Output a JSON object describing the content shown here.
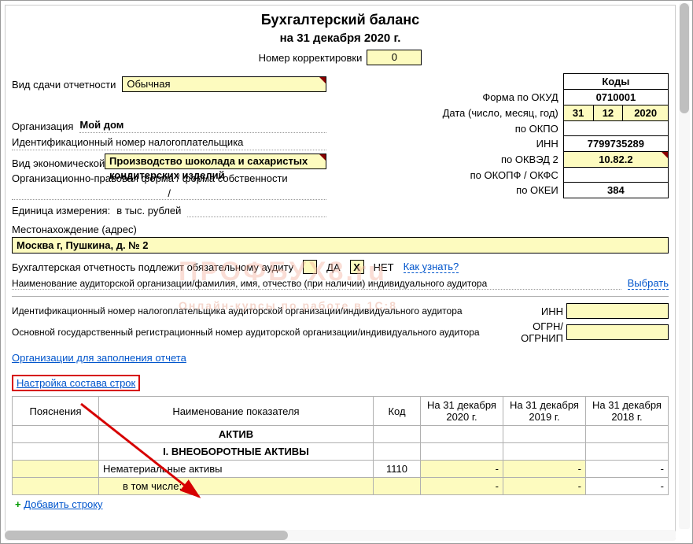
{
  "header": {
    "title": "Бухгалтерский баланс",
    "subtitle": "на 31 декабря 2020 г.",
    "correction_label": "Номер корректировки",
    "correction_value": "0"
  },
  "submission": {
    "label": "Вид сдачи отчетности",
    "value": "Обычная"
  },
  "codes": {
    "header": "Коды",
    "okud_label": "Форма по ОКУД",
    "okud": "0710001",
    "date_label": "Дата (число, месяц, год)",
    "date_day": "31",
    "date_month": "12",
    "date_year": "2020",
    "okpo_label": "по ОКПО",
    "okpo": "",
    "inn_label": "ИНН",
    "inn": "7799735289",
    "okved_label": "по ОКВЭД 2",
    "okved": "10.82.2",
    "okopf_label": "по ОКОПФ / ОКФС",
    "okopf": "",
    "okei_label": "по ОКЕИ",
    "okei": "384"
  },
  "org": {
    "label": "Организация",
    "name": "Мой дом",
    "inn_tax_label": "Идентификационный номер налогоплательщика",
    "activity_label": "Вид экономической деятельности",
    "activity": "Производство шоколада и сахаристых кондитерских изделий",
    "legal_form_label": "Организационно-правовая форма / форма собственности",
    "legal_form": "/",
    "units_label": "Единица измерения:",
    "units": "в тыс. рублей",
    "address_label": "Местонахождение (адрес)",
    "address": "Москва г, Пушкина, д. № 2"
  },
  "audit": {
    "label": "Бухгалтерская отчетность подлежит обязательному аудиту",
    "yes": "ДА",
    "no": "НЕТ",
    "no_checked": "Х",
    "how_link": "Как узнать?",
    "aud_name_label": "Наименование аудиторской организации/фамилия, имя, отчество (при наличии) индивидуального аудитора",
    "select_link": "Выбрать",
    "aud_inn_label": "Идентификационный номер налогоплательщика аудиторской организации/индивидуального аудитора",
    "aud_inn_short": "ИНН",
    "aud_ogrn_label": "Основной государственный регистрационный номер аудиторской организации/индивидуального аудитора",
    "aud_ogrn_short": "ОГРН/ ОГРНИП"
  },
  "links": {
    "org_fill": "Организации для заполнения отчета",
    "config_rows": "Настройка состава строк",
    "add_row": "Добавить строку"
  },
  "table": {
    "col_explain": "Пояснения",
    "col_name": "Наименование показателя",
    "col_code": "Код",
    "col_y0": "На 31 декабря 2020 г.",
    "col_y1": "На 31 декабря 2019 г.",
    "col_y2": "На 31 декабря 2018 г.",
    "section1": "АКТИВ",
    "section2": "I. ВНЕОБОРОТНЫЕ АКТИВЫ",
    "row1_name": "Нематериальные активы",
    "row1_code": "1110",
    "row2_name": "в том числе:"
  },
  "watermark": {
    "line1": "ПРОФБУХ8.ru",
    "line2": "Онлайн-курсы по работе в 1С:8"
  },
  "chart_data": null
}
